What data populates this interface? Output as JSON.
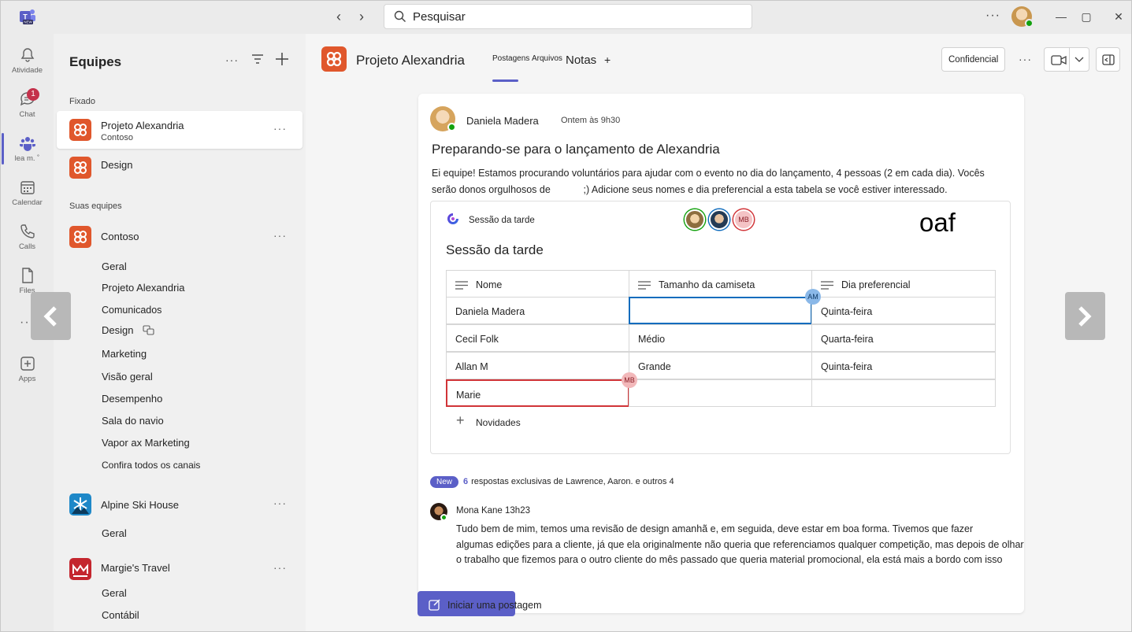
{
  "app": {
    "search_placeholder": "Pesquisar",
    "more": "···"
  },
  "rail": {
    "items": [
      {
        "label": "Atividade",
        "icon": "bell-icon"
      },
      {
        "label": "Chat",
        "icon": "chat-icon",
        "badge": "1"
      },
      {
        "label": "lea m. ˚",
        "icon": "teams-icon"
      },
      {
        "label": "Calendar",
        "icon": "calendar-icon"
      },
      {
        "label": "Calls",
        "icon": "phone-icon"
      },
      {
        "label": "Files",
        "icon": "file-icon"
      },
      {
        "label": "···",
        "icon": "more-icon"
      },
      {
        "label": "Apps",
        "icon": "apps-icon"
      }
    ]
  },
  "panel": {
    "title": "Equipes",
    "pinned_label": "Fixado",
    "your_teams_label": "Suas equipes",
    "pinned": [
      {
        "name": "Projeto Alexandria",
        "sub": "Contoso"
      },
      {
        "name": "Design",
        "sub": ""
      }
    ],
    "teams": [
      {
        "name": "Contoso",
        "channels": [
          "Geral",
          "Projeto Alexandria",
          "Comunicados",
          "Design",
          "Marketing",
          "Visão geral",
          "Desempenho",
          "Sala do navio",
          "Vapor ax Marketing",
          "Confira todos os canais"
        ]
      },
      {
        "name": "Alpine Ski House",
        "channels": [
          "Geral"
        ]
      },
      {
        "name": "Margie's Travel",
        "channels": [
          "Geral",
          "Contábil"
        ]
      }
    ]
  },
  "header": {
    "channel_title": "Projeto Alexandria",
    "tabs": [
      "Postagens",
      "Arquivos",
      "Notas",
      "+"
    ],
    "confidential": "Confidencial"
  },
  "post": {
    "author": "Daniela Madera",
    "time": "Ontem às 9h30",
    "title": "Preparando-se para o lançamento de Alexandria",
    "body_line1": "Ei equipe! Estamos procurando voluntários para ajudar com o evento no dia do lançamento, 4 pessoas (2 em cada dia). Vocês",
    "body_line2": "serão donos orgulhosos de            ;) Adicione seus nomes e dia preferencial a esta tabela se você estiver interessado.",
    "loop": {
      "component_label": "Sessão da tarde",
      "oaf": "oaf",
      "title": "Sessão da tarde",
      "collab_mb": "MB",
      "columns": [
        "Nome",
        "Tamanho da camiseta",
        "Dia preferencial"
      ],
      "rows": [
        [
          "Daniela Madera",
          "",
          "Quinta-feira"
        ],
        [
          "Cecil Folk",
          "Médio",
          "Quarta-feira"
        ],
        [
          "Allan M",
          "Grande",
          "Quinta-feira"
        ],
        [
          "Marie",
          "",
          ""
        ]
      ],
      "cursor_am": "AM",
      "cursor_mb": "MB",
      "add_label": "Novidades"
    },
    "replies": {
      "new_badge": "New",
      "count": "6",
      "text": "respostas exclusivas de Lawrence, Aaron. e outros 4"
    },
    "reply": {
      "author_time": "Mona Kane 13h23",
      "line1": "Tudo bem de mim, temos uma revisão de design amanhã e, em seguida, deve estar em boa forma. Tivemos que fazer",
      "line2": "algumas edições para a cliente, já que ela originalmente não queria que referenciamos qualquer competição, mas depois de olhar para",
      "line3": "o trabalho que fizemos para o outro cliente do mês passado que queria material promocional, ela está mais a bordo com isso"
    }
  },
  "compose": {
    "start_post": "Iniciar uma postagem"
  },
  "colors": {
    "accent": "#5b5fc7",
    "brand_orange": "#e0572c",
    "presence_green": "#13a10e",
    "cursor_blue": "#0f6cbd",
    "cursor_red": "#d13438"
  }
}
